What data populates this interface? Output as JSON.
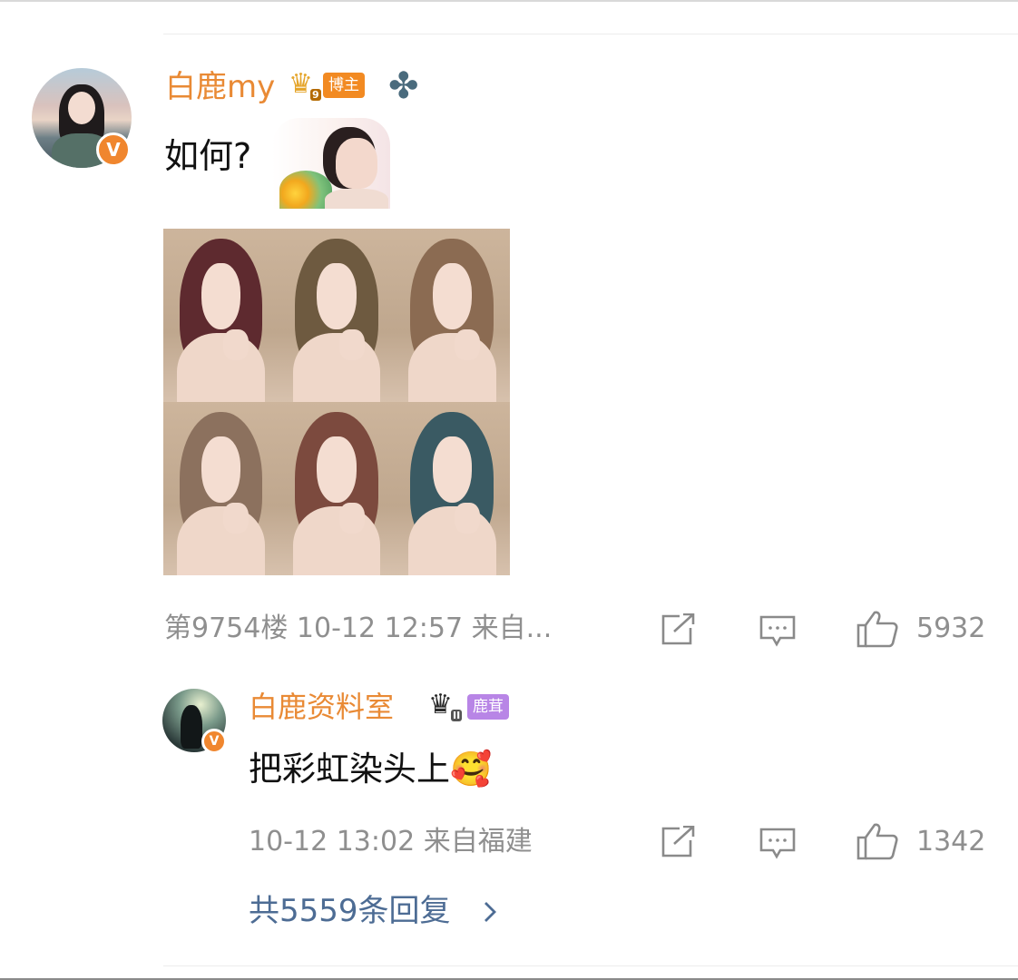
{
  "main_comment": {
    "username": "白鹿my",
    "crown_level": "9",
    "tag": "博主",
    "text": "如何?",
    "floor": "第9754楼",
    "datetime": "10-12 12:57",
    "source": "来自...",
    "like_count": "5932",
    "icons": [
      "verified-v-badge",
      "crown-icon",
      "clover-icon",
      "sticker",
      "share-icon",
      "chat-icon",
      "like-icon"
    ]
  },
  "reply": {
    "username": "白鹿资料室",
    "crown_level": "II",
    "tag": "鹿茸",
    "text": "把彩虹染头上",
    "emoji": "🥰",
    "datetime": "10-12 13:02",
    "source": "来自福建",
    "like_count": "1342"
  },
  "more_replies": {
    "label": "共5559条回复",
    "chevron": "›"
  },
  "photos": [
    {
      "hair_color": "#5e2a2f"
    },
    {
      "hair_color": "#6e5a40"
    },
    {
      "hair_color": "#8b6b52"
    },
    {
      "hair_color": "#8c715e"
    },
    {
      "hair_color": "#7c4a3e"
    },
    {
      "hair_color": "#3a5a63"
    }
  ],
  "colors": {
    "username": "#e98a35",
    "meta_gray": "#8f8f8f",
    "link_blue": "#4d6c94",
    "blogger_tag": "#f28a22",
    "fan_tag": "#b885e6",
    "verified_orange": "#f0862e"
  }
}
